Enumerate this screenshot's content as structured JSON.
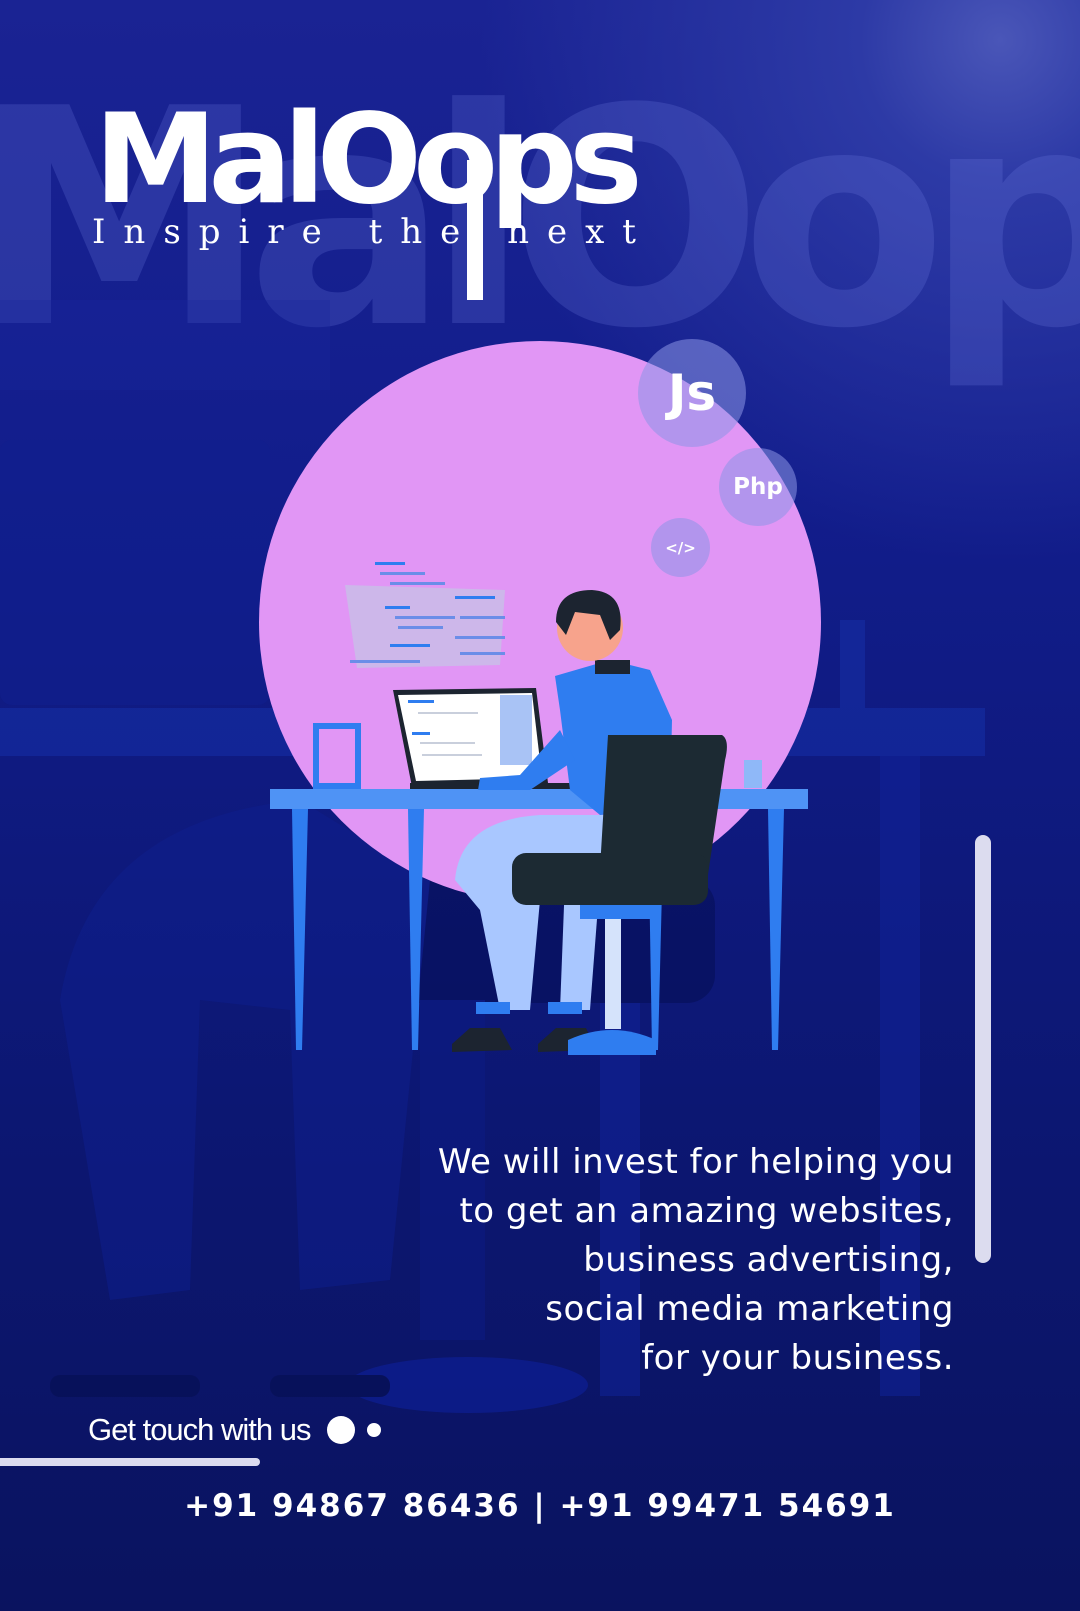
{
  "brand": {
    "background_word": "MalOops",
    "logo": "MalOops",
    "tagline": "Inspire the next"
  },
  "tech_badges": [
    "Js",
    "Php",
    "</>"
  ],
  "pitch": {
    "lines": [
      "We will invest for helping you",
      "to get an amazing websites,",
      "business advertising,",
      "social media marketing",
      "for your business."
    ]
  },
  "contact": {
    "label": "Get touch with us",
    "phones": "+91 94867 86436 | +91 99471 54691"
  },
  "colors": {
    "background": "#0b1466",
    "circle": "#e196f5",
    "accent_blue": "#2f7df0",
    "text": "#ffffff",
    "bar": "#dcdcef"
  }
}
